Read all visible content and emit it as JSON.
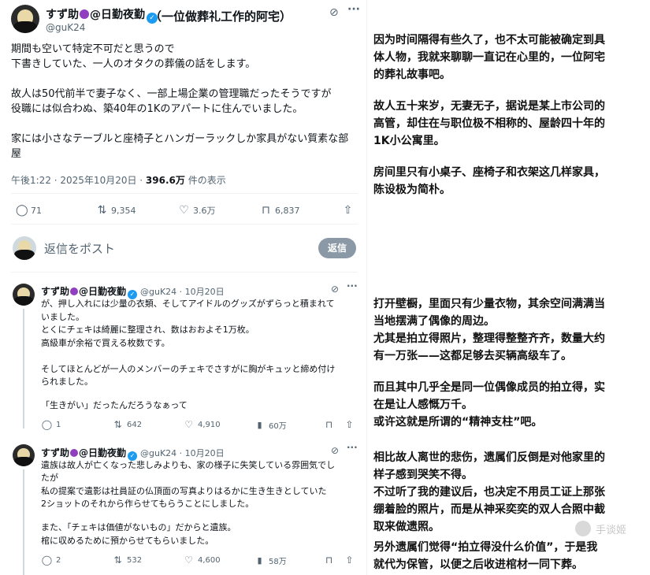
{
  "main_tweet": {
    "name": "すず助",
    "name_suffix": "@日勤夜勤",
    "handle": "@guK24",
    "caption": "（一位做葬礼工作的阿宅）",
    "lines": [
      "期間も空いて特定不可だと思うので",
      "下書きしていた、一人のオタクの葬儀の話をします。",
      "",
      "故人は50代前半で妻子なく、一部上場企業の管理職だったそうですが",
      "役職には似合わぬ、築40年の1Kのアパートに住んでいました。",
      "",
      "家には小さなテーブルと座椅子とハンガーラックしか家具がない質素な部",
      "屋"
    ],
    "meta_time": "午後1:22 · 2025年10月20日 · ",
    "meta_views": "396.6万",
    "meta_views_label": " 件の表示",
    "replies": "71",
    "retweets": "9,354",
    "likes": "3.6万",
    "bookmarks": "6,837"
  },
  "reply_box": {
    "placeholder": "返信をポスト",
    "button": "返信"
  },
  "reply1": {
    "name": "すず助",
    "name_suffix": "@日勤夜勤",
    "handle": "@guK24 · 10月20日",
    "lines": [
      "が、押し入れには少量の衣類、そしてアイドルのグッズがずらっと積まれて",
      "いました。",
      "とくにチェキは綺麗に整理され、数はおおよそ1万枚。",
      "高級車が余裕で買える枚数です。",
      "",
      "そしてほとんどが一人のメンバーのチェキでさすがに胸がキュッと締め付け",
      "られました。",
      "",
      "「生きがい」だったんだろうなぁって"
    ],
    "replies": "1",
    "retweets": "642",
    "likes": "4,910",
    "views": "60万"
  },
  "reply2": {
    "name": "すず助",
    "name_suffix": "@日勤夜勤",
    "handle": "@guK24 · 10月20日",
    "lines": [
      "遺族は故人が亡くなった悲しみよりも、家の様子に失笑している雰囲気でし",
      "たが",
      "私の提案で遺影は社員証の仏頂面の写真よりはるかに生き生きとしていた",
      "2ショットのそれから作らせてもらうことにしました。",
      "",
      "また、「チェキは価値がないもの」だからと遺族。",
      "棺に収めるために預からせてもらいました。"
    ],
    "replies": "2",
    "retweets": "532",
    "likes": "4,600",
    "views": "58万"
  },
  "translation": {
    "block1": [
      "因为时间隔得有些久了，也不太可能被确定到具",
      "体人物，我就来聊聊一直记在心里的，一位阿宅",
      "的葬礼故事吧。"
    ],
    "block2": [
      "故人五十来岁，无妻无子，据说是某上市公司的",
      "高管，却住在与职位极不相称的、屋龄四十年的",
      "1K小公寓里。"
    ],
    "block3": [
      "房间里只有小桌子、座椅子和衣架这几样家具，",
      "陈设极为简朴。"
    ],
    "block4": [
      "打开壁橱，里面只有少量衣物，其余空间满满当",
      "当地摆满了偶像的周边。",
      "尤其是拍立得照片，整理得整整齐齐，数量大约",
      "有一万张——这都足够去买辆高级车了。"
    ],
    "block5": [
      "而且其中几乎全是同一位偶像成员的拍立得，实",
      "在是让人感慨万千。",
      "或许这就是所谓的“精神支柱”吧。"
    ],
    "block6": [
      "相比故人离世的悲伤，遗属们反倒是对他家里的",
      "样子感到哭笑不得。",
      "不过听了我的建议后，也决定不用员工证上那张",
      "绷着脸的照片，而是从神采奕奕的双人合照中截",
      "取来做遗照。"
    ],
    "block7": [
      "另外遗属们觉得“拍立得没什么价值”，于是我",
      "就代为保管，以便之后收进棺材一同下葬。"
    ],
    "watermark": "手谈姬"
  }
}
